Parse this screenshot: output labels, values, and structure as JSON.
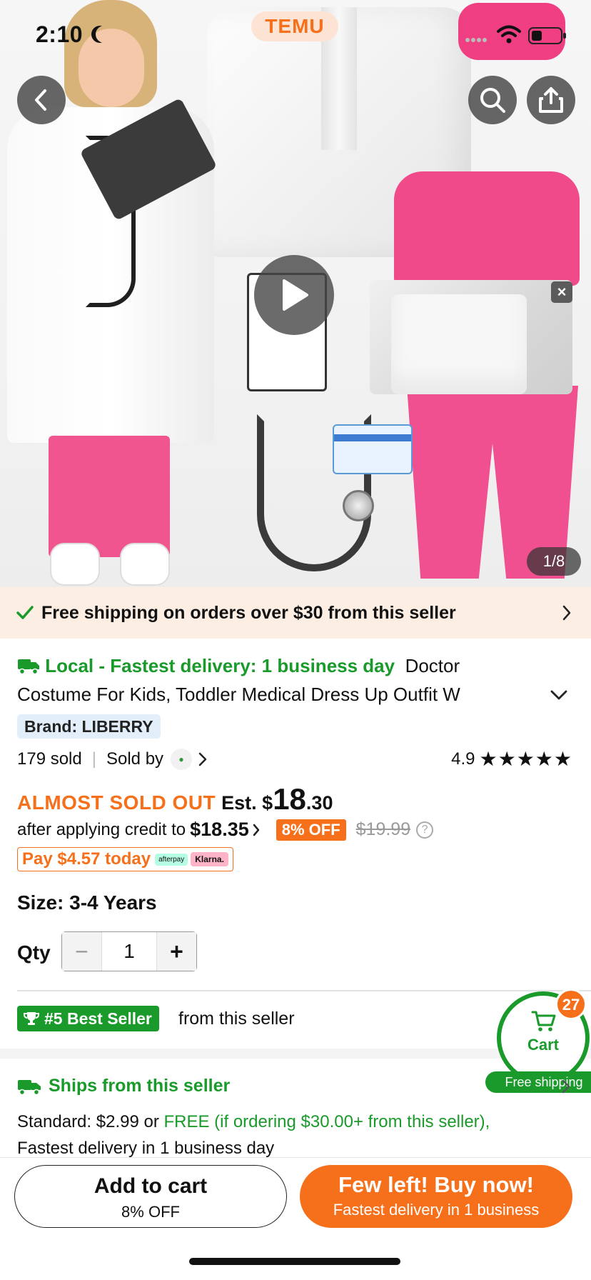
{
  "status_bar": {
    "time": "2:10"
  },
  "brand_logo": "TEMU",
  "gallery": {
    "counter": "1/8"
  },
  "shipping_banner": {
    "text": "Free shipping on orders over $30 from this seller"
  },
  "product": {
    "delivery_tag": "Local - Fastest delivery: 1 business day",
    "title_part1": "Doctor",
    "title_part2": "Costume For Kids, Toddler Medical Dress Up Outfit W",
    "brand": "Brand: LIBERRY",
    "sold": "179 sold",
    "sold_by": "Sold by",
    "rating": "4.9",
    "stars": "★★★★★"
  },
  "price": {
    "almost_sold_out": "ALMOST SOLD OUT",
    "est": "Est. $",
    "dollars": "18",
    "cents": ".30",
    "after_credit": "after applying credit to",
    "credit_amount": "$18.35",
    "discount_badge": "8% OFF",
    "original": "$19.99",
    "pay_today": "Pay $4.57 today",
    "afterpay": "afterpay",
    "klarna": "Klarna."
  },
  "options": {
    "size": "Size: 3-4 Years",
    "qty_label": "Qty",
    "qty_value": "1",
    "qty_minus": "−",
    "qty_plus": "+"
  },
  "best_seller": {
    "badge": "#5 Best Seller",
    "suffix": "from this seller"
  },
  "cart": {
    "count": "27",
    "label": "Cart",
    "free_shipping": "Free shipping"
  },
  "ships": {
    "title": "Ships from this seller",
    "standard": "Standard: $2.99 or ",
    "free_text": "FREE (if ordering $30.00+ from this seller),",
    "fastest": "Fastest delivery in 1 business day"
  },
  "actions": {
    "add_to_cart": "Add to cart",
    "add_sub": "8% OFF",
    "buy_now": "Few left! Buy now!",
    "buy_sub": "Fastest delivery in 1 business"
  },
  "colors": {
    "accent_orange": "#f6701b",
    "green": "#1a9a2a"
  }
}
